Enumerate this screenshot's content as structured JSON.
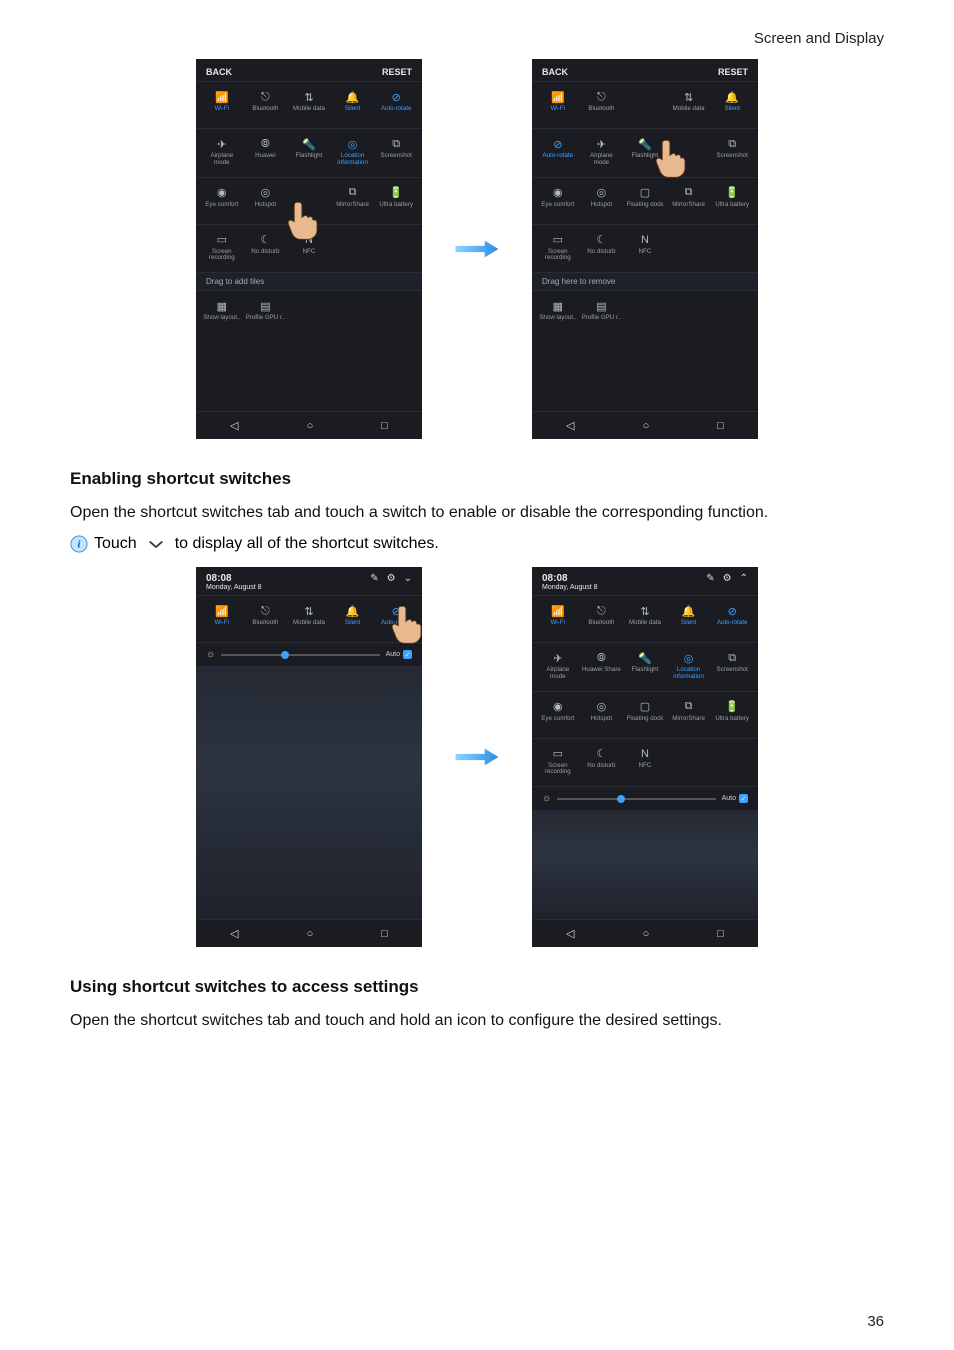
{
  "header": {
    "section_title": "Screen and Display"
  },
  "fig1": {
    "back": "BACK",
    "reset": "RESET",
    "drag_add": "Drag to add tiles",
    "drag_remove": "Drag here to remove",
    "rows_left": [
      [
        {
          "label": "Wi-Fi",
          "glyph": "📶",
          "on": true
        },
        {
          "label": "Bluetooth",
          "glyph": "⎋",
          "on": false
        },
        {
          "label": "Mobile data",
          "glyph": "⇅",
          "on": false
        },
        {
          "label": "Silent",
          "glyph": "🔔",
          "on": true
        },
        {
          "label": "Auto-rotate",
          "glyph": "⊘",
          "on": true
        }
      ],
      [
        {
          "label": "Airplane mode",
          "glyph": "✈",
          "on": false
        },
        {
          "label": "Huawei",
          "glyph": "⦾",
          "on": false
        },
        {
          "label": "Flashlight",
          "glyph": "🔦",
          "on": false
        },
        {
          "label": "Location\ninformation",
          "glyph": "◎",
          "on": true
        },
        {
          "label": "Screenshot",
          "glyph": "⧉",
          "on": false
        }
      ],
      [
        {
          "label": "Eye comfort",
          "glyph": "◉",
          "on": false
        },
        {
          "label": "Hotspot",
          "glyph": "◎",
          "on": false
        },
        {
          "label": "",
          "glyph": "",
          "on": false
        },
        {
          "label": "MirrorShare",
          "glyph": "⧉",
          "on": false
        },
        {
          "label": "Ultra battery",
          "glyph": "🔋",
          "on": false
        }
      ],
      [
        {
          "label": "Screen\nrecording",
          "glyph": "▭",
          "on": false
        },
        {
          "label": "No disturb",
          "glyph": "☾",
          "on": false
        },
        {
          "label": "NFC",
          "glyph": "N",
          "on": false
        },
        {
          "label": "",
          "glyph": "",
          "on": false
        },
        {
          "label": "",
          "glyph": "",
          "on": false
        }
      ]
    ],
    "extra_left": [
      {
        "label": "Show layout..",
        "glyph": "▦",
        "on": false
      },
      {
        "label": "Profile GPU r..",
        "glyph": "▤",
        "on": false
      }
    ],
    "rows_right": [
      [
        {
          "label": "Wi-Fi",
          "glyph": "📶",
          "on": true
        },
        {
          "label": "Bluetooth",
          "glyph": "⎋",
          "on": false
        },
        {
          "label": "",
          "glyph": "",
          "on": false
        },
        {
          "label": "Mobile data",
          "glyph": "⇅",
          "on": false
        },
        {
          "label": "Silent",
          "glyph": "🔔",
          "on": true
        }
      ],
      [
        {
          "label": "Auto-rotate",
          "glyph": "⊘",
          "on": true
        },
        {
          "label": "Airplane mode",
          "glyph": "✈",
          "on": false
        },
        {
          "label": "Flashlight",
          "glyph": "🔦",
          "on": false
        },
        {
          "label": "",
          "glyph": "",
          "on": false
        },
        {
          "label": "Screenshot",
          "glyph": "⧉",
          "on": false
        }
      ],
      [
        {
          "label": "Eye comfort",
          "glyph": "◉",
          "on": false
        },
        {
          "label": "Hotspot",
          "glyph": "◎",
          "on": false
        },
        {
          "label": "Floating dock",
          "glyph": "▢",
          "on": false
        },
        {
          "label": "MirrorShare",
          "glyph": "⧉",
          "on": false
        },
        {
          "label": "Ultra battery",
          "glyph": "🔋",
          "on": false
        }
      ],
      [
        {
          "label": "Screen\nrecording",
          "glyph": "▭",
          "on": false
        },
        {
          "label": "No disturb",
          "glyph": "☾",
          "on": false
        },
        {
          "label": "NFC",
          "glyph": "N",
          "on": false
        },
        {
          "label": "",
          "glyph": "",
          "on": false
        },
        {
          "label": "",
          "glyph": "",
          "on": false
        }
      ]
    ],
    "extra_right": [
      {
        "label": "Show layout..",
        "glyph": "▦",
        "on": false
      },
      {
        "label": "Profile GPU r..",
        "glyph": "▤",
        "on": false
      }
    ]
  },
  "section1": {
    "heading": "Enabling shortcut switches",
    "body": "Open the shortcut switches tab and touch a switch to enable or disable the corresponding function.",
    "tip_pre": "Touch",
    "tip_post": "to display all of the shortcut switches."
  },
  "fig2": {
    "time": "08:08",
    "day": "Monday, August 8",
    "auto": "Auto",
    "rows_left": [
      [
        {
          "label": "Wi-Fi",
          "glyph": "📶",
          "on": true
        },
        {
          "label": "Bluetooth",
          "glyph": "⎋",
          "on": false
        },
        {
          "label": "Mobile data",
          "glyph": "⇅",
          "on": false
        },
        {
          "label": "Silent",
          "glyph": "🔔",
          "on": true
        },
        {
          "label": "Auto-rotate",
          "glyph": "⊘",
          "on": true
        }
      ]
    ],
    "rows_right": [
      [
        {
          "label": "Wi-Fi",
          "glyph": "📶",
          "on": true
        },
        {
          "label": "Bluetooth",
          "glyph": "⎋",
          "on": false
        },
        {
          "label": "Mobile data",
          "glyph": "⇅",
          "on": false
        },
        {
          "label": "Silent",
          "glyph": "🔔",
          "on": true
        },
        {
          "label": "Auto-rotate",
          "glyph": "⊘",
          "on": true
        }
      ],
      [
        {
          "label": "Airplane mode",
          "glyph": "✈",
          "on": false
        },
        {
          "label": "Huawei Share",
          "glyph": "⦾",
          "on": false
        },
        {
          "label": "Flashlight",
          "glyph": "🔦",
          "on": false
        },
        {
          "label": "Location\ninformation",
          "glyph": "◎",
          "on": true
        },
        {
          "label": "Screenshot",
          "glyph": "⧉",
          "on": false
        }
      ],
      [
        {
          "label": "Eye comfort",
          "glyph": "◉",
          "on": false
        },
        {
          "label": "Hotspot",
          "glyph": "◎",
          "on": false
        },
        {
          "label": "Floating dock",
          "glyph": "▢",
          "on": false
        },
        {
          "label": "MirrorShare",
          "glyph": "⧉",
          "on": false
        },
        {
          "label": "Ultra battery",
          "glyph": "🔋",
          "on": false
        }
      ],
      [
        {
          "label": "Screen\nrecording",
          "glyph": "▭",
          "on": false
        },
        {
          "label": "No disturb",
          "glyph": "☾",
          "on": false
        },
        {
          "label": "NFC",
          "glyph": "N",
          "on": false
        },
        {
          "label": "",
          "glyph": "",
          "on": false
        },
        {
          "label": "",
          "glyph": "",
          "on": false
        }
      ]
    ]
  },
  "section2": {
    "heading": "Using shortcut switches to access settings",
    "body": "Open the shortcut switches tab and touch and hold an icon to configure the desired settings."
  },
  "page_number": "36"
}
